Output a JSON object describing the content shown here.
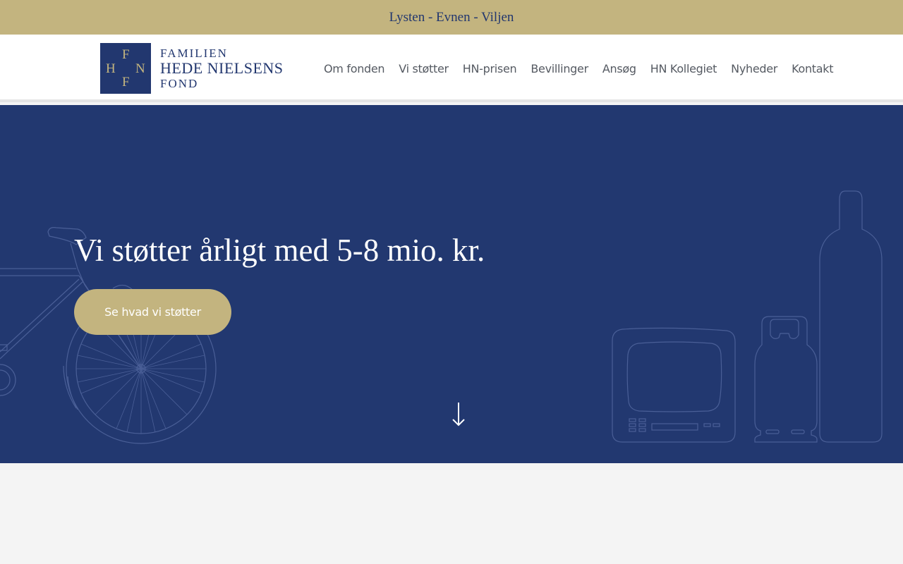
{
  "topbar": {
    "tagline": "Lysten - Evnen - Viljen"
  },
  "header": {
    "logo": {
      "mark_letters": [
        "F",
        "H",
        "N",
        "F"
      ],
      "line1": "FAMILIEN",
      "line2": "HEDE NIELSENS",
      "line3": "FOND"
    },
    "nav": [
      {
        "label": "Om fonden"
      },
      {
        "label": "Vi støtter"
      },
      {
        "label": "HN-prisen"
      },
      {
        "label": "Bevillinger"
      },
      {
        "label": "Ansøg"
      },
      {
        "label": "HN Kollegiet"
      },
      {
        "label": "Nyheder"
      },
      {
        "label": "Kontakt"
      }
    ]
  },
  "hero": {
    "title": "Vi støtter årligt med 5-8 mio. kr.",
    "cta_label": "Se hvad vi støtter"
  },
  "colors": {
    "gold": "#c3b47f",
    "navy": "#223870",
    "nav_text": "#555a62",
    "page_bg": "#f4f4f4"
  },
  "icons": {
    "scroll": "arrow-down-icon"
  }
}
